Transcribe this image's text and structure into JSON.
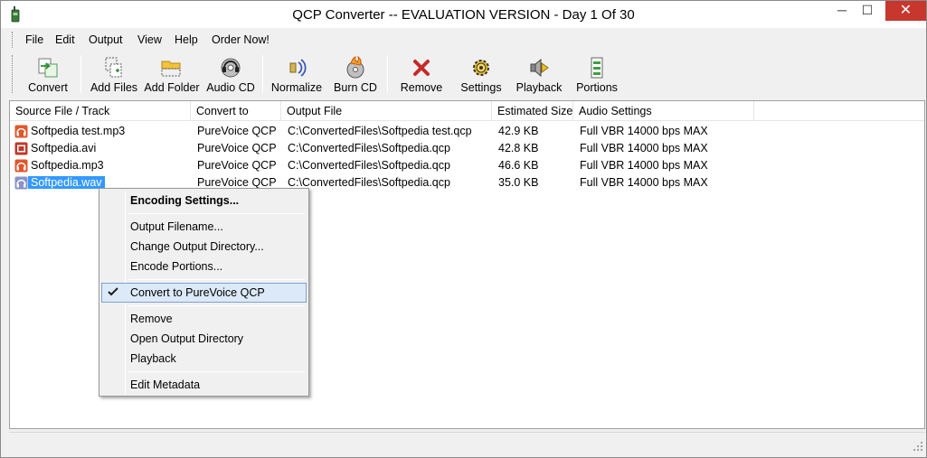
{
  "window": {
    "title": "QCP Converter -- EVALUATION VERSION - Day 1 Of 30",
    "controls": {
      "minimize": "─",
      "maximize": "☐",
      "close": "✕"
    }
  },
  "menu": {
    "file": "File",
    "edit": "Edit",
    "output": "Output",
    "view": "View",
    "help": "Help",
    "order": "Order Now!"
  },
  "toolbar": {
    "convert": "Convert",
    "add_files": "Add Files",
    "add_folder": "Add Folder",
    "audio_cd": "Audio CD",
    "normalize": "Normalize",
    "burn_cd": "Burn CD",
    "remove": "Remove",
    "settings": "Settings",
    "playback": "Playback",
    "portions": "Portions"
  },
  "list": {
    "columns": {
      "source": "Source File / Track",
      "convert_to": "Convert to",
      "output_file": "Output File",
      "size": "Estimated Size",
      "audio": "Audio Settings"
    },
    "rows": [
      {
        "name": "Softpedia test.mp3",
        "icon": "audio-file-icon",
        "convert_to": "PureVoice QCP",
        "output": "C:\\ConvertedFiles\\Softpedia test.qcp",
        "size": "42.9 KB",
        "audio": "Full VBR 14000 bps MAX"
      },
      {
        "name": "Softpedia.avi",
        "icon": "video-file-icon",
        "convert_to": "PureVoice QCP",
        "output": "C:\\ConvertedFiles\\Softpedia.qcp",
        "size": "42.8 KB",
        "audio": "Full VBR 14000 bps MAX"
      },
      {
        "name": "Softpedia.mp3",
        "icon": "audio-file-icon",
        "convert_to": "PureVoice QCP",
        "output": "C:\\ConvertedFiles\\Softpedia.qcp",
        "size": "46.6 KB",
        "audio": "Full VBR 14000 bps MAX"
      },
      {
        "name": "Softpedia.wav",
        "icon": "audio-file-icon",
        "convert_to": "PureVoice QCP",
        "output": "C:\\ConvertedFiles\\Softpedia.qcp",
        "size": "35.0 KB",
        "audio": "Full VBR 14000 bps MAX",
        "selected": true
      }
    ]
  },
  "context_menu": {
    "encoding_settings": "Encoding Settings...",
    "output_filename": "Output Filename...",
    "change_output_dir": "Change Output Directory...",
    "encode_portions": "Encode Portions...",
    "convert_to_qcp": "Convert to PureVoice QCP",
    "remove": "Remove",
    "open_output_dir": "Open Output Directory",
    "playback": "Playback",
    "edit_metadata": "Edit Metadata"
  },
  "colors": {
    "selection": "#3399ff",
    "close_button": "#c7372e",
    "menu_highlight": "#dce9f8"
  }
}
